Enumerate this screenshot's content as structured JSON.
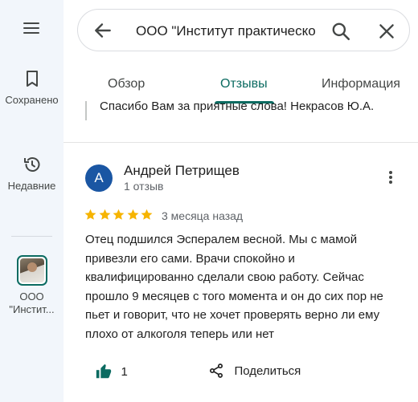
{
  "sidebar": {
    "saved_label": "Сохранено",
    "recent_label": "Недавние",
    "place_label": "ООО \"Инстит..."
  },
  "search": {
    "query": "ООО \"Институт практическо"
  },
  "tabs": [
    {
      "label": "Обзор"
    },
    {
      "label": "Отзывы"
    },
    {
      "label": "Информация"
    }
  ],
  "previous_reply": {
    "text": "Спасибо Вам за приятные слова! Некрасов Ю.А."
  },
  "review": {
    "avatar_letter": "А",
    "author": "Андрей Петрищев",
    "author_meta": "1 отзыв",
    "rating": 5,
    "date": "3 месяца назад",
    "text": "Отец подшился Эспералем весной. Мы с мамой привезли его сами. Врачи спокойно и квалифицированно сделали свою работу. Сейчас прошло 9 месяцев с того момента и он до сих пор не пьет и говорит, что не хочет проверять верно ли ему плохо от алкоголя теперь или нет",
    "likes": "1",
    "share_label": "Поделиться"
  },
  "colors": {
    "accent": "#0b6b61",
    "star": "#f6b400",
    "avatar_bg": "#1a56a3",
    "like_icon": "#0b6b61"
  }
}
